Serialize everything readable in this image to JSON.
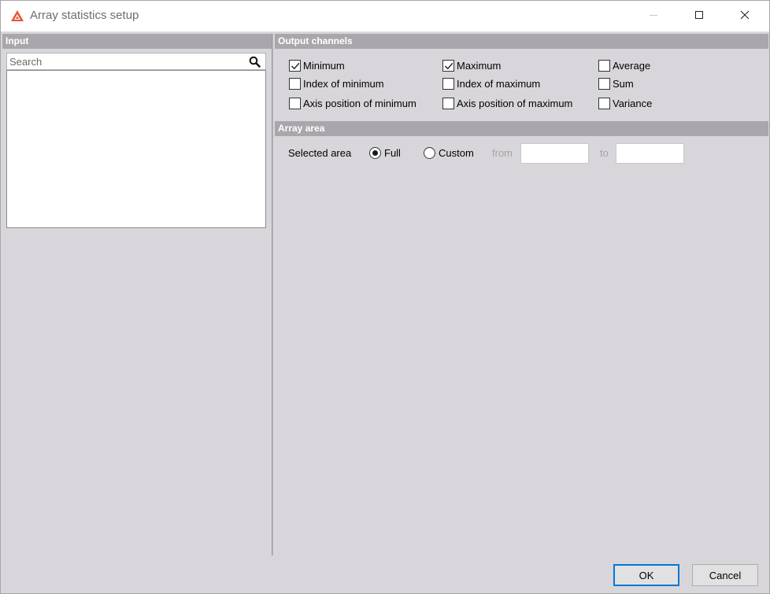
{
  "window": {
    "title": "Array statistics setup",
    "icons": {
      "app": "app-logo-icon",
      "minimize": "minimize-icon",
      "maximize": "maximize-icon",
      "close": "close-icon"
    }
  },
  "input_panel": {
    "header": "Input",
    "search": {
      "placeholder": "Search",
      "value": "",
      "icon": "search-icon"
    }
  },
  "output_channels": {
    "header": "Output channels",
    "items": [
      {
        "label": "Minimum",
        "checked": true
      },
      {
        "label": "Maximum",
        "checked": true
      },
      {
        "label": "Average",
        "checked": false
      },
      {
        "label": "Index of minimum",
        "checked": false
      },
      {
        "label": "Index of maximum",
        "checked": false
      },
      {
        "label": "Sum",
        "checked": false
      },
      {
        "label": "Axis position of minimum",
        "checked": false
      },
      {
        "label": "Axis position of maximum",
        "checked": false
      },
      {
        "label": "Variance",
        "checked": false
      }
    ]
  },
  "array_area": {
    "header": "Array area",
    "selected_area_label": "Selected area",
    "options": [
      {
        "label": "Full",
        "selected": true
      },
      {
        "label": "Custom",
        "selected": false
      }
    ],
    "from_label": "from",
    "from_value": "",
    "to_label": "to",
    "to_value": ""
  },
  "buttons": {
    "ok": "OK",
    "cancel": "Cancel"
  }
}
